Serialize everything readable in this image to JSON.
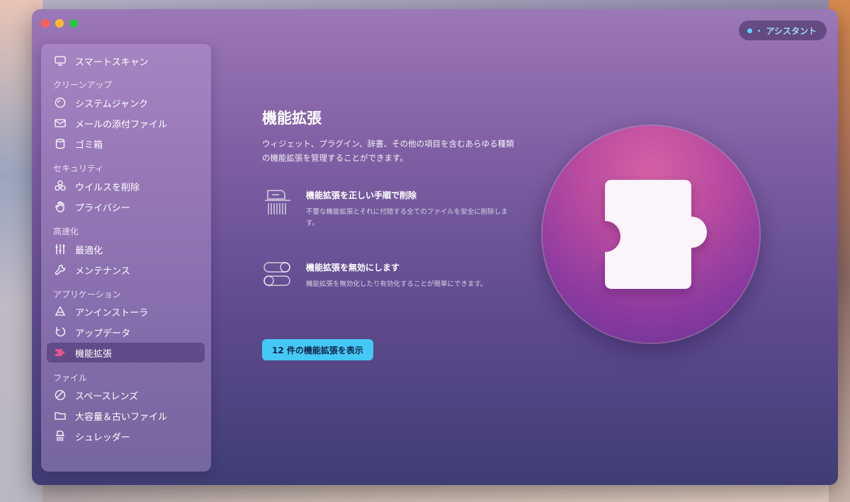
{
  "window": {
    "assistant_label": "アシスタント"
  },
  "sidebar": {
    "items": [
      {
        "label": "スマートスキャン"
      },
      {
        "label": "システムジャンク"
      },
      {
        "label": "メールの添付ファイル"
      },
      {
        "label": "ゴミ箱"
      },
      {
        "label": "ウイルスを削除"
      },
      {
        "label": "プライバシー"
      },
      {
        "label": "最適化"
      },
      {
        "label": "メンテナンス"
      },
      {
        "label": "アンインストーラ"
      },
      {
        "label": "アップデータ"
      },
      {
        "label": "機能拡張",
        "selected": true
      },
      {
        "label": "スペースレンズ"
      },
      {
        "label": "大容量＆古いファイル"
      },
      {
        "label": "シュレッダー"
      }
    ],
    "sections": [
      "クリーンアップ",
      "セキュリティ",
      "高速化",
      "アプリケーション",
      "ファイル"
    ]
  },
  "main": {
    "title": "機能拡張",
    "description": "ウィジェット、プラグイン、辞書、その他の項目を含むあらゆる種類の機能拡張を管理することができます。",
    "features": [
      {
        "title": "機能拡張を正しい手順で削除",
        "description": "不要な機能拡張とそれに付随する全てのファイルを安全に削除します。",
        "icon": "shredder-icon"
      },
      {
        "title": "機能拡張を無効にします",
        "description": "機能拡張を無効化したり有効化することが簡単にできます。",
        "icon": "toggle-icon"
      }
    ],
    "cta_label": "12 件の機能拡張を表示"
  },
  "colors": {
    "accent": "#45c8f5",
    "active_icon": "#e0568f"
  }
}
